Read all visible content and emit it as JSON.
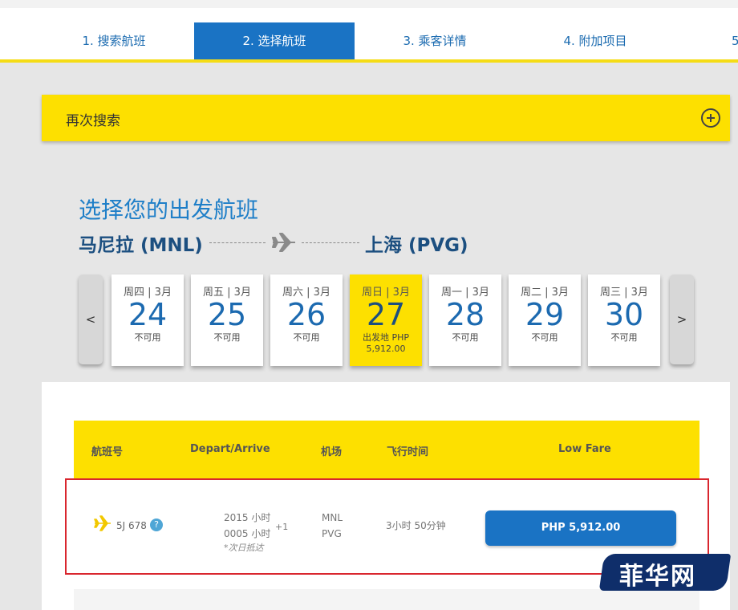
{
  "steps": [
    {
      "label": "1. 搜索航班"
    },
    {
      "label": "2. 选择航班"
    },
    {
      "label": "3. 乘客详情"
    },
    {
      "label": "4. 附加项目"
    },
    {
      "label": "5"
    }
  ],
  "research": {
    "label": "再次搜索",
    "icon": "plus-circle-icon"
  },
  "heading": {
    "title": "选择您的出发航班",
    "origin": "马尼拉 (MNL)",
    "destination": "上海 (PVG)"
  },
  "dates": {
    "prev": "<",
    "next": ">",
    "items": [
      {
        "dow": "周四 | 3月",
        "day": "24",
        "status": "不可用"
      },
      {
        "dow": "周五 | 3月",
        "day": "25",
        "status": "不可用"
      },
      {
        "dow": "周六 | 3月",
        "day": "26",
        "status": "不可用"
      },
      {
        "dow": "周日 | 3月",
        "day": "27",
        "status": "出发地 PHP",
        "price": "5,912.00"
      },
      {
        "dow": "周一 | 3月",
        "day": "28",
        "status": "不可用"
      },
      {
        "dow": "周二 | 3月",
        "day": "29",
        "status": "不可用"
      },
      {
        "dow": "周三 | 3月",
        "day": "30",
        "status": "不可用"
      }
    ]
  },
  "table": {
    "headers": [
      "航班号",
      "Depart/Arrive",
      "机场",
      "飞行时间",
      "Low Fare"
    ],
    "row": {
      "flight_no": "5J 678",
      "help": "?",
      "depart": "2015 小时",
      "arrive": "0005 小时",
      "plus_day": "+1",
      "next_day_note": "*次日抵达",
      "from": "MNL",
      "to": "PVG",
      "duration": "3小时 50分钟",
      "price": "PHP 5,912.00"
    }
  },
  "watermark": {
    "text": "菲华网"
  },
  "colors": {
    "brand_blue": "#1a73c4",
    "brand_yellow": "#fde000",
    "highlight_red": "#d9262e"
  }
}
